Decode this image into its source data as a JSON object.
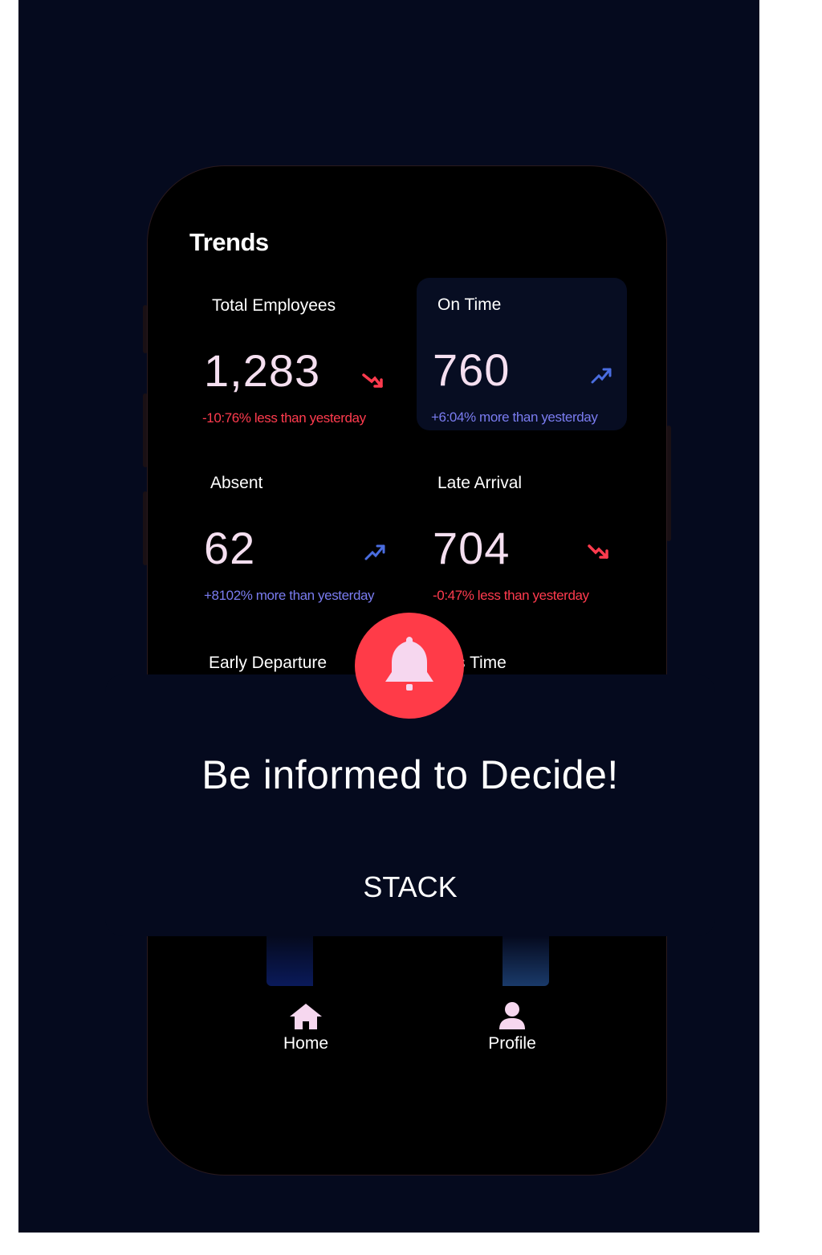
{
  "screen": {
    "title": "Trends"
  },
  "cards": [
    {
      "label": "Total Employees",
      "value": "1,283",
      "delta": "-10:76% less than yesterday",
      "trend": "down",
      "icon": "trend-down-icon"
    },
    {
      "label": "On Time",
      "value": "760",
      "delta": "+6:04% more than yesterday",
      "trend": "up",
      "icon": "trend-up-icon"
    },
    {
      "label": "Absent",
      "value": "62",
      "delta": "+8102% more than yesterday",
      "trend": "up",
      "icon": "trend-up-icon"
    },
    {
      "label": "Late Arrival",
      "value": "704",
      "delta": "-0:47% less than yesterday",
      "trend": "down",
      "icon": "trend-down-icon"
    }
  ],
  "partial_cards": [
    {
      "label": "Early Departure"
    },
    {
      "label": "s Time"
    }
  ],
  "banner": {
    "headline": "Be informed to Decide!",
    "brand": "STACK",
    "icon": "bell-icon"
  },
  "nav": {
    "items": [
      {
        "label": "Home",
        "icon": "home-icon"
      },
      {
        "label": "Profile",
        "icon": "profile-icon"
      }
    ]
  },
  "colors": {
    "background": "#050a1e",
    "negative": "#ff3b4e",
    "positive": "#7a7cf0",
    "accent": "#ff3b48"
  }
}
